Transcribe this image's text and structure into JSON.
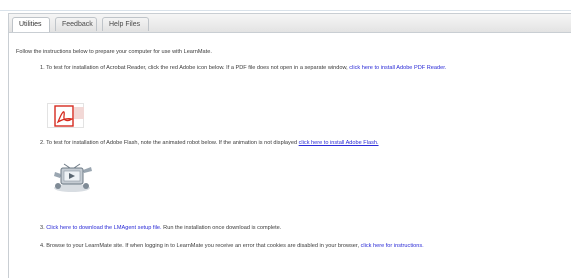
{
  "tabs": [
    {
      "label": "Utilities"
    },
    {
      "label": "Feedback"
    },
    {
      "label": "Help Files"
    }
  ],
  "content": {
    "intro": "Follow the instructions below to prepare your computer for use with LearnMate.",
    "step1": {
      "text": "1. To test for installation of Acrobat Reader, click the red Adobe icon below. If a PDF file does not open in a separate window, ",
      "link": "click here to install Adobe PDF Reader."
    },
    "step2": {
      "text": "2. To test for installation of Adobe Flash, note the animated robot below. If the animation is not displayed ",
      "link": "click here to install Adobe Flash."
    },
    "step3": {
      "prefix": "3. ",
      "link": "Click here to download the LMAgent setup file.",
      "text": " Run the installation once download is complete."
    },
    "step4": {
      "text": "4. Browse to your LearnMate site. If when logging in to LearnMate you receive an error that cookies are disabled in your browser, ",
      "link": "click here for instructions."
    }
  },
  "icons": {
    "adobe": "adobe-reader-icon",
    "flash": "flash-robot-icon"
  },
  "colors": {
    "link": "#2a2ad6",
    "adobe_red": "#d62b1f"
  }
}
